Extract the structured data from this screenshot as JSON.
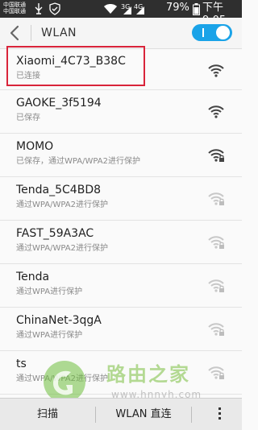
{
  "status_bar": {
    "carrier_1": "中国联通",
    "carrier_2": "中国联通",
    "network_3g": "3G",
    "network_4g": "4G",
    "battery": "79%",
    "time": "下午9:05"
  },
  "header": {
    "title": "WLAN",
    "wlan_switch": "on"
  },
  "networks": [
    {
      "ssid": "Xiaomi_4C73_B38C",
      "status": "已连接",
      "secured": false,
      "strength": "full"
    },
    {
      "ssid": "GAOKE_3f5194",
      "status": "已保存",
      "secured": false,
      "strength": "full"
    },
    {
      "ssid": "MOMO",
      "status": "已保存，通过WPA/WPA2进行保护",
      "secured": true,
      "strength": "full"
    },
    {
      "ssid": "Tenda_5C4BD8",
      "status": "通过WPA/WPA2进行保护",
      "secured": true,
      "strength": "weak"
    },
    {
      "ssid": "FAST_59A3AC",
      "status": "通过WPA/WPA2进行保护",
      "secured": true,
      "strength": "weak"
    },
    {
      "ssid": "Tenda",
      "status": "通过WPA进行保护",
      "secured": true,
      "strength": "weak"
    },
    {
      "ssid": "ChinaNet-3qgA",
      "status": "通过WPA进行保护",
      "secured": true,
      "strength": "weak"
    },
    {
      "ssid": "ts",
      "status": "通过WPA/WPA2进行保护",
      "secured": true,
      "strength": "weak"
    }
  ],
  "watermark": {
    "title": "路由之家",
    "url": "www.hnnyh.com"
  },
  "bottom_bar": {
    "scan_label": "扫描",
    "direct_label": "WLAN 直连"
  },
  "colors": {
    "accent": "#1aa3e8",
    "highlight": "#d9243a",
    "status_bar": "#2f2f2f"
  }
}
